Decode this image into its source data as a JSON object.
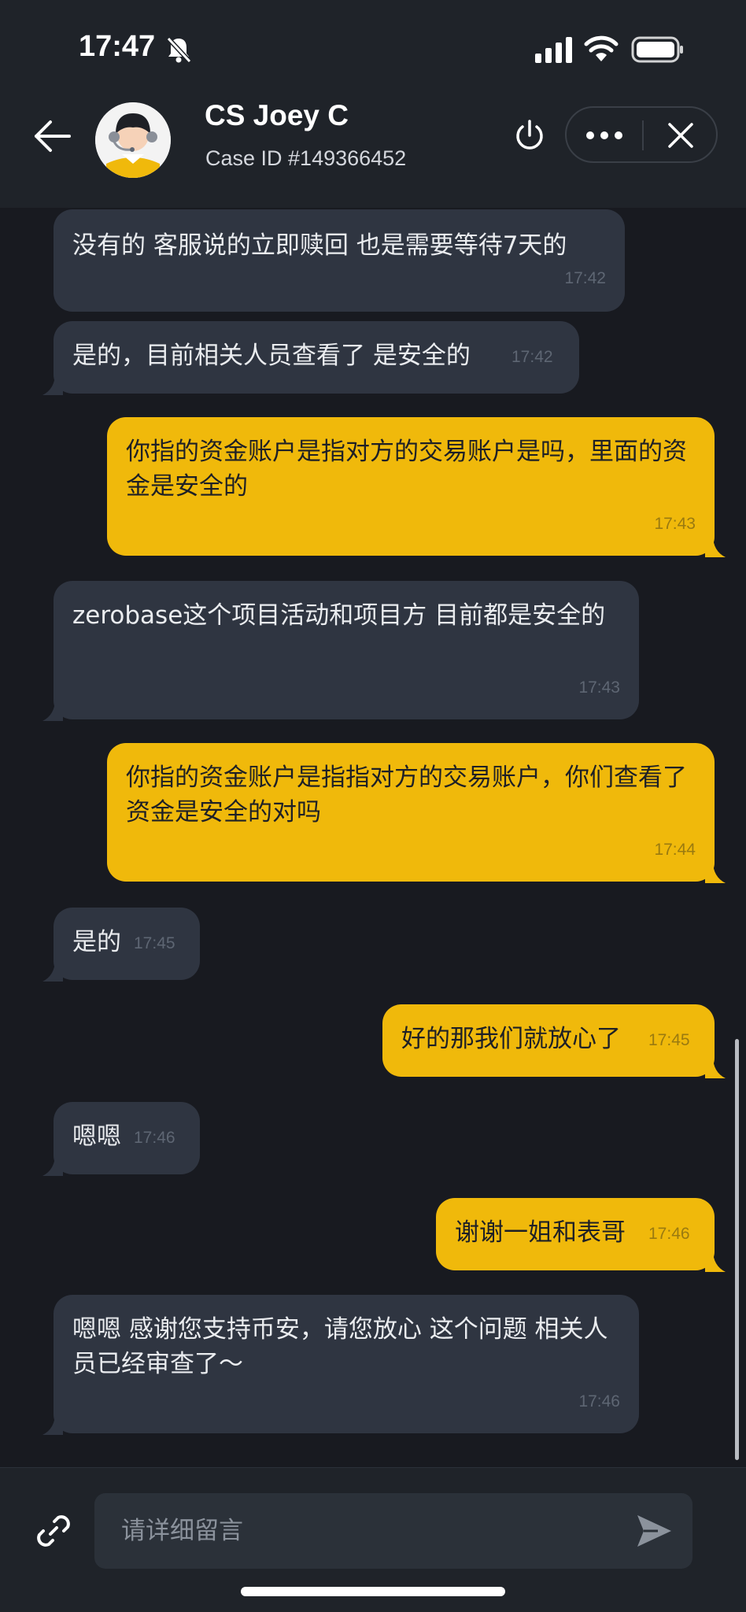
{
  "status_bar": {
    "time": "17:47"
  },
  "header": {
    "agent_name": "CS Joey C",
    "case_id": "Case ID #149366452"
  },
  "messages": [
    {
      "side": "in",
      "text": "没有的 客服说的立即赎回 也是需要等待7天的",
      "time": "17:42"
    },
    {
      "side": "in",
      "text": "是的，目前相关人员查看了 是安全的",
      "time": "17:42"
    },
    {
      "side": "out",
      "text": "你指的资金账户是指对方的交易账户是吗，里面的资金是安全的",
      "time": "17:43"
    },
    {
      "side": "in",
      "text": "zerobase这个项目活动和项目方 目前都是安全的",
      "time": "17:43"
    },
    {
      "side": "out",
      "text": "你指的资金账户是指指对方的交易账户，你们查看了资金是安全的对吗",
      "time": "17:44"
    },
    {
      "side": "in",
      "text": "是的",
      "time": "17:45"
    },
    {
      "side": "out",
      "text": "好的那我们就放心了",
      "time": "17:45"
    },
    {
      "side": "in",
      "text": "嗯嗯",
      "time": "17:46"
    },
    {
      "side": "out",
      "text": "谢谢一姐和表哥",
      "time": "17:46"
    },
    {
      "side": "in",
      "text": "嗯嗯 感谢您支持币安，请您放心 这个问题 相关人员已经审查了～",
      "time": "17:46"
    }
  ],
  "composer": {
    "placeholder": "请详细留言"
  },
  "colors": {
    "incoming_bubble": "#2f3541",
    "outgoing_bubble": "#f0b90b",
    "background": "#181a20",
    "header": "#1f2329"
  },
  "icons": [
    "bell-slash-icon",
    "signal-icon",
    "wifi-icon",
    "battery-icon",
    "back-arrow-icon",
    "power-icon",
    "more-icon",
    "close-icon",
    "link-icon",
    "send-icon"
  ]
}
